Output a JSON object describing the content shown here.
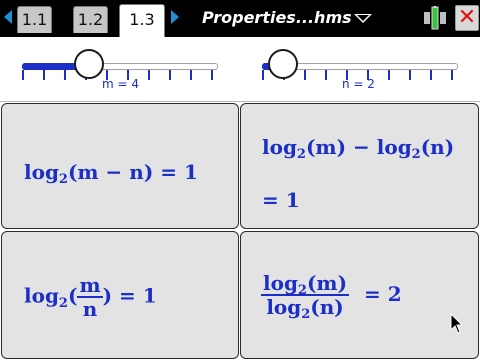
{
  "colors": {
    "accent": "#1b2fc7",
    "topbar": "#000000",
    "panel": "#e3e3e3"
  },
  "tabs": [
    {
      "label": "1.1",
      "active": false
    },
    {
      "label": "1.2",
      "active": false
    },
    {
      "label": "1.3",
      "active": true
    }
  ],
  "document_title": "Properties...hms",
  "sliders": [
    {
      "label": "m = 4",
      "value": 4,
      "min": 1,
      "max": 10
    },
    {
      "label": "n = 2",
      "value": 2,
      "min": 1,
      "max": 10
    }
  ],
  "panels": {
    "p1": {
      "log": "log",
      "base": "2",
      "arg": "(m − n) = 1"
    },
    "p2": {
      "line1_log_a": "log",
      "base_a": "2",
      "arg_a": "(m) − ",
      "line1_log_b": "log",
      "base_b": "2",
      "arg_b": "(n)",
      "line2": "=  1"
    },
    "p3": {
      "log": "log",
      "base": "2",
      "open": "(",
      "num": "m",
      "den": "n",
      "close": ") = 1"
    },
    "p4": {
      "num_log": "log",
      "num_base": "2",
      "num_arg": "(m)",
      "den_log": "log",
      "den_base": "2",
      "den_arg": "(n)",
      "rhs": "= 2"
    }
  },
  "icons": {
    "nav_left": "nav-left-icon",
    "nav_right": "nav-right-icon",
    "battery": "battery-icon",
    "close": "close-icon",
    "cursor": "mouse-pointer-icon"
  }
}
